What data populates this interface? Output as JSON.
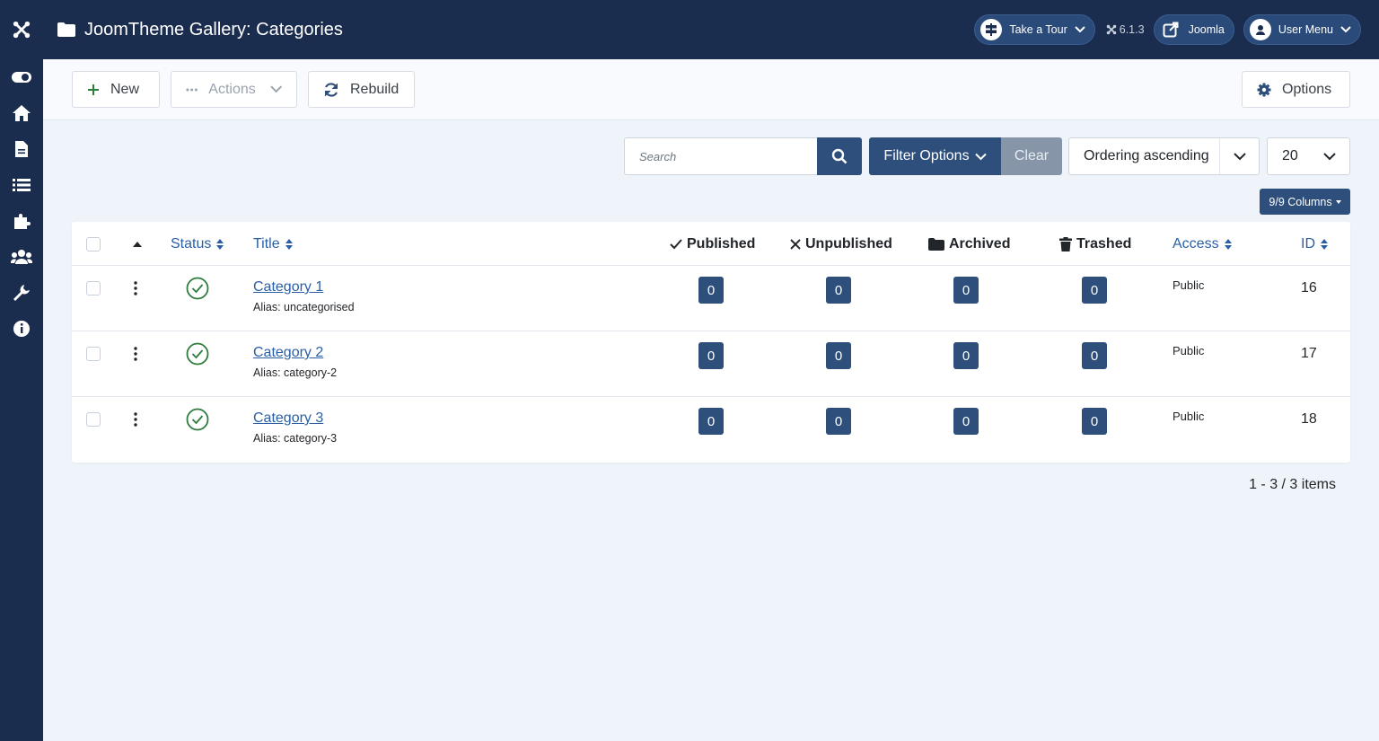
{
  "app": {
    "page_title": "JoomTheme Gallery: Categories",
    "version": "6.1.3"
  },
  "header": {
    "take_tour_label": "Take a Tour",
    "joomla_label": "Joomla",
    "user_menu_label": "User Menu"
  },
  "sidebar": {
    "items": [
      {
        "icon": "toggle-icon"
      },
      {
        "icon": "home-icon"
      },
      {
        "icon": "file-icon"
      },
      {
        "icon": "list-icon"
      },
      {
        "icon": "puzzle-icon"
      },
      {
        "icon": "users-icon"
      },
      {
        "icon": "wrench-icon"
      },
      {
        "icon": "info-icon"
      }
    ]
  },
  "toolbar": {
    "new_label": "New",
    "actions_label": "Actions",
    "rebuild_label": "Rebuild",
    "options_label": "Options"
  },
  "filters": {
    "search_placeholder": "Search",
    "filter_options_label": "Filter Options",
    "clear_label": "Clear",
    "ordering_value": "Ordering ascending",
    "limit_value": "20",
    "columns_label": "9/9 Columns"
  },
  "table": {
    "headers": {
      "status": "Status",
      "title": "Title",
      "published": "Published",
      "unpublished": "Unpublished",
      "archived": "Archived",
      "trashed": "Trashed",
      "access": "Access",
      "id": "ID"
    },
    "rows": [
      {
        "title": "Category 1",
        "alias": "Alias: uncategorised",
        "published": "0",
        "unpublished": "0",
        "archived": "0",
        "trashed": "0",
        "access": "Public",
        "id": "16"
      },
      {
        "title": "Category 2",
        "alias": "Alias: category-2",
        "published": "0",
        "unpublished": "0",
        "archived": "0",
        "trashed": "0",
        "access": "Public",
        "id": "17"
      },
      {
        "title": "Category 3",
        "alias": "Alias: category-3",
        "published": "0",
        "unpublished": "0",
        "archived": "0",
        "trashed": "0",
        "access": "Public",
        "id": "18"
      }
    ]
  },
  "pagination": {
    "summary": "1 - 3 / 3 items"
  },
  "colors": {
    "header_bg": "#1b2d4f",
    "primary": "#2e4f7c",
    "link": "#2a5fa5",
    "success": "#2f7d3c"
  }
}
